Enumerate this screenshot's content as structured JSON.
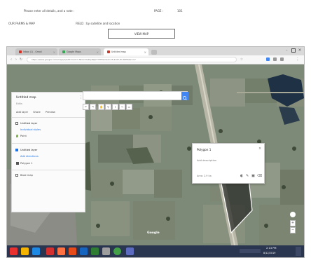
{
  "document": {
    "line1_left": "Please enter all details, and a note :",
    "line1_mid": "PAGE :",
    "line1_right": "101",
    "line2_left": "OUR FARMS & MAP",
    "line2_right": "FIELD : by satellite and location",
    "box_button": "VIEW MAP"
  },
  "browser": {
    "tabs": [
      {
        "label": "Inbox (1) - Gmail"
      },
      {
        "label": "Google Maps"
      },
      {
        "label": "Untitled map"
      }
    ],
    "url": "https://www.google.com/maps/d/edit?mid=1-Nk2vrUeRquBjlVvY5tFGm&ll=25.4167,81.8833&z=17",
    "active_tab_color": "#ffffff",
    "accent": "#4285f4"
  },
  "panel": {
    "title": "Untitled map",
    "subtitle": "Edits",
    "actions": [
      "Add layer",
      "Share",
      "Preview"
    ],
    "layer1_title": "Untitled layer",
    "layer1_style": "Individual styles",
    "layer1_item": "Point",
    "layer2_title": "Untitled layer",
    "layer2_link": "Add directions",
    "layer2_item": "Polygon 1",
    "basemap": "Base map"
  },
  "popup": {
    "title": "Polygon 1",
    "description": "Add description",
    "footer": "Area: 2.9 ha",
    "icons": [
      "paint-icon",
      "edit-icon",
      "photo-icon",
      "delete-icon"
    ]
  },
  "map_attribution": "Google",
  "taskbar": {
    "clock_time": "2:13 PM",
    "clock_date": "8/12/2019"
  }
}
